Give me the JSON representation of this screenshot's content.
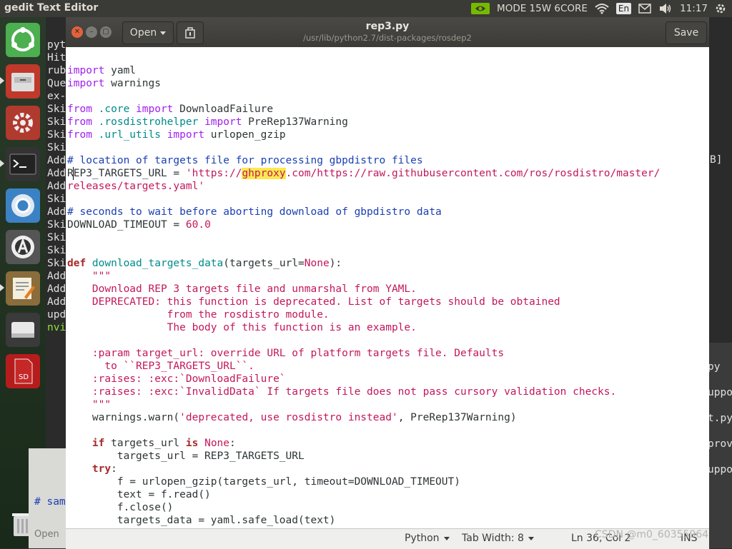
{
  "topbar": {
    "app_name": "gedit Text Editor",
    "mode": "MODE 15W 6CORE",
    "lang": "En",
    "time": "11:17"
  },
  "launcher": {
    "items": [
      "ubuntu-dash-icon",
      "file-manager-icon",
      "system-settings-icon",
      "terminal-icon",
      "chromium-icon",
      "software-updater-icon",
      "gedit-icon",
      "drive-icon",
      "sd-card-icon",
      "trash-icon"
    ]
  },
  "background_terminal": {
    "lines": [
      "pyt",
      "Hit",
      "rub",
      "Que",
      "ex-",
      "Ski",
      "Ski",
      "Ski",
      "Ski",
      "Add",
      "Add",
      "Add",
      "Ski",
      "Add",
      "Ski",
      "Ski",
      "Ski",
      "Ski",
      "Add",
      "Add",
      "Add",
      "upd",
      "nvi"
    ],
    "right_bracket": "B]",
    "right_fragments": [
      "py",
      "uppo",
      "t.py",
      "prov",
      "uppo"
    ],
    "bottom_left_text": "# sam",
    "bottom_left_text2": "Open"
  },
  "gedit": {
    "open_label": "Open",
    "title": "rep3.py",
    "path": "/usr/lib/python2.7/dist-packages/rosdep2",
    "save_label": "Save",
    "status": {
      "language": "Python",
      "tab_width": "Tab Width: 8",
      "position": "Ln 36, Col 2",
      "mode": "INS"
    },
    "code": {
      "l1_kw": "import",
      "l1_rest": " yaml",
      "l2_kw": "import",
      "l2_rest": " warnings",
      "l3_kw": "from",
      "l3_mod": " .core ",
      "l3_kw2": "import",
      "l3_rest": " DownloadFailure",
      "l4_kw": "from",
      "l4_mod": " .rosdistrohelper ",
      "l4_kw2": "import",
      "l4_rest": " PreRep137Warning",
      "l5_kw": "from",
      "l5_mod": " .url_utils ",
      "l5_kw2": "import",
      "l5_rest": " urlopen_gzip",
      "l6_cmt": "# location of targets file for processing gbpdistro files",
      "l7_pre": "REP3_TARGETS_URL = ",
      "l7_str1": "'https://",
      "l7_hl": "ghproxy",
      "l7_str2": ".com/https://raw.githubusercontent.com/ros/rosdistro/master/",
      "l8_str": "releases/targets.yaml'",
      "l9_cmt": "# seconds to wait before aborting download of gbpdistro data",
      "l10_pre": "DOWNLOAD_TIMEOUT = ",
      "l10_num": "60.0",
      "l11_kw": "def",
      "l11_fn": " download_targets_data",
      "l11_a": "(targets_url=",
      "l11_none": "None",
      "l11_b": "):",
      "l12": "    \"\"\"",
      "l13": "    Download REP 3 targets file and unmarshal from YAML.",
      "l14": "    DEPRECATED: this function is deprecated. List of targets should be obtained",
      "l15": "                from the rosdistro module.",
      "l16": "                The body of this function is an example.",
      "l17": "    :param target_url: override URL of platform targets file. Defaults",
      "l18": "      to ``REP3_TARGETS_URL``.",
      "l19": "    :raises: :exc:`DownloadFailure`",
      "l20": "    :raises: :exc:`InvalidData` If targets file does not pass cursory validation checks.",
      "l21": "    \"\"\"",
      "l22_pre": "    warnings.warn(",
      "l22_str": "'deprecated, use rosdistro instead'",
      "l22_post": ", PreRep137Warning)",
      "l23_ind": "    ",
      "l23_kw": "if",
      "l23_mid": " targets_url ",
      "l23_kw2": "is",
      "l23_none": " None",
      "l23_post": ":",
      "l24": "        targets_url = REP3_TARGETS_URL",
      "l25_ind": "    ",
      "l25_kw": "try",
      "l25_post": ":",
      "l26": "        f = urlopen_gzip(targets_url, timeout=DOWNLOAD_TIMEOUT)",
      "l27": "        text = f.read()",
      "l28": "        f.close()",
      "l29": "        targets_data = yaml.safe_load(text)"
    }
  },
  "watermark": "CSDN @m0_60355964"
}
